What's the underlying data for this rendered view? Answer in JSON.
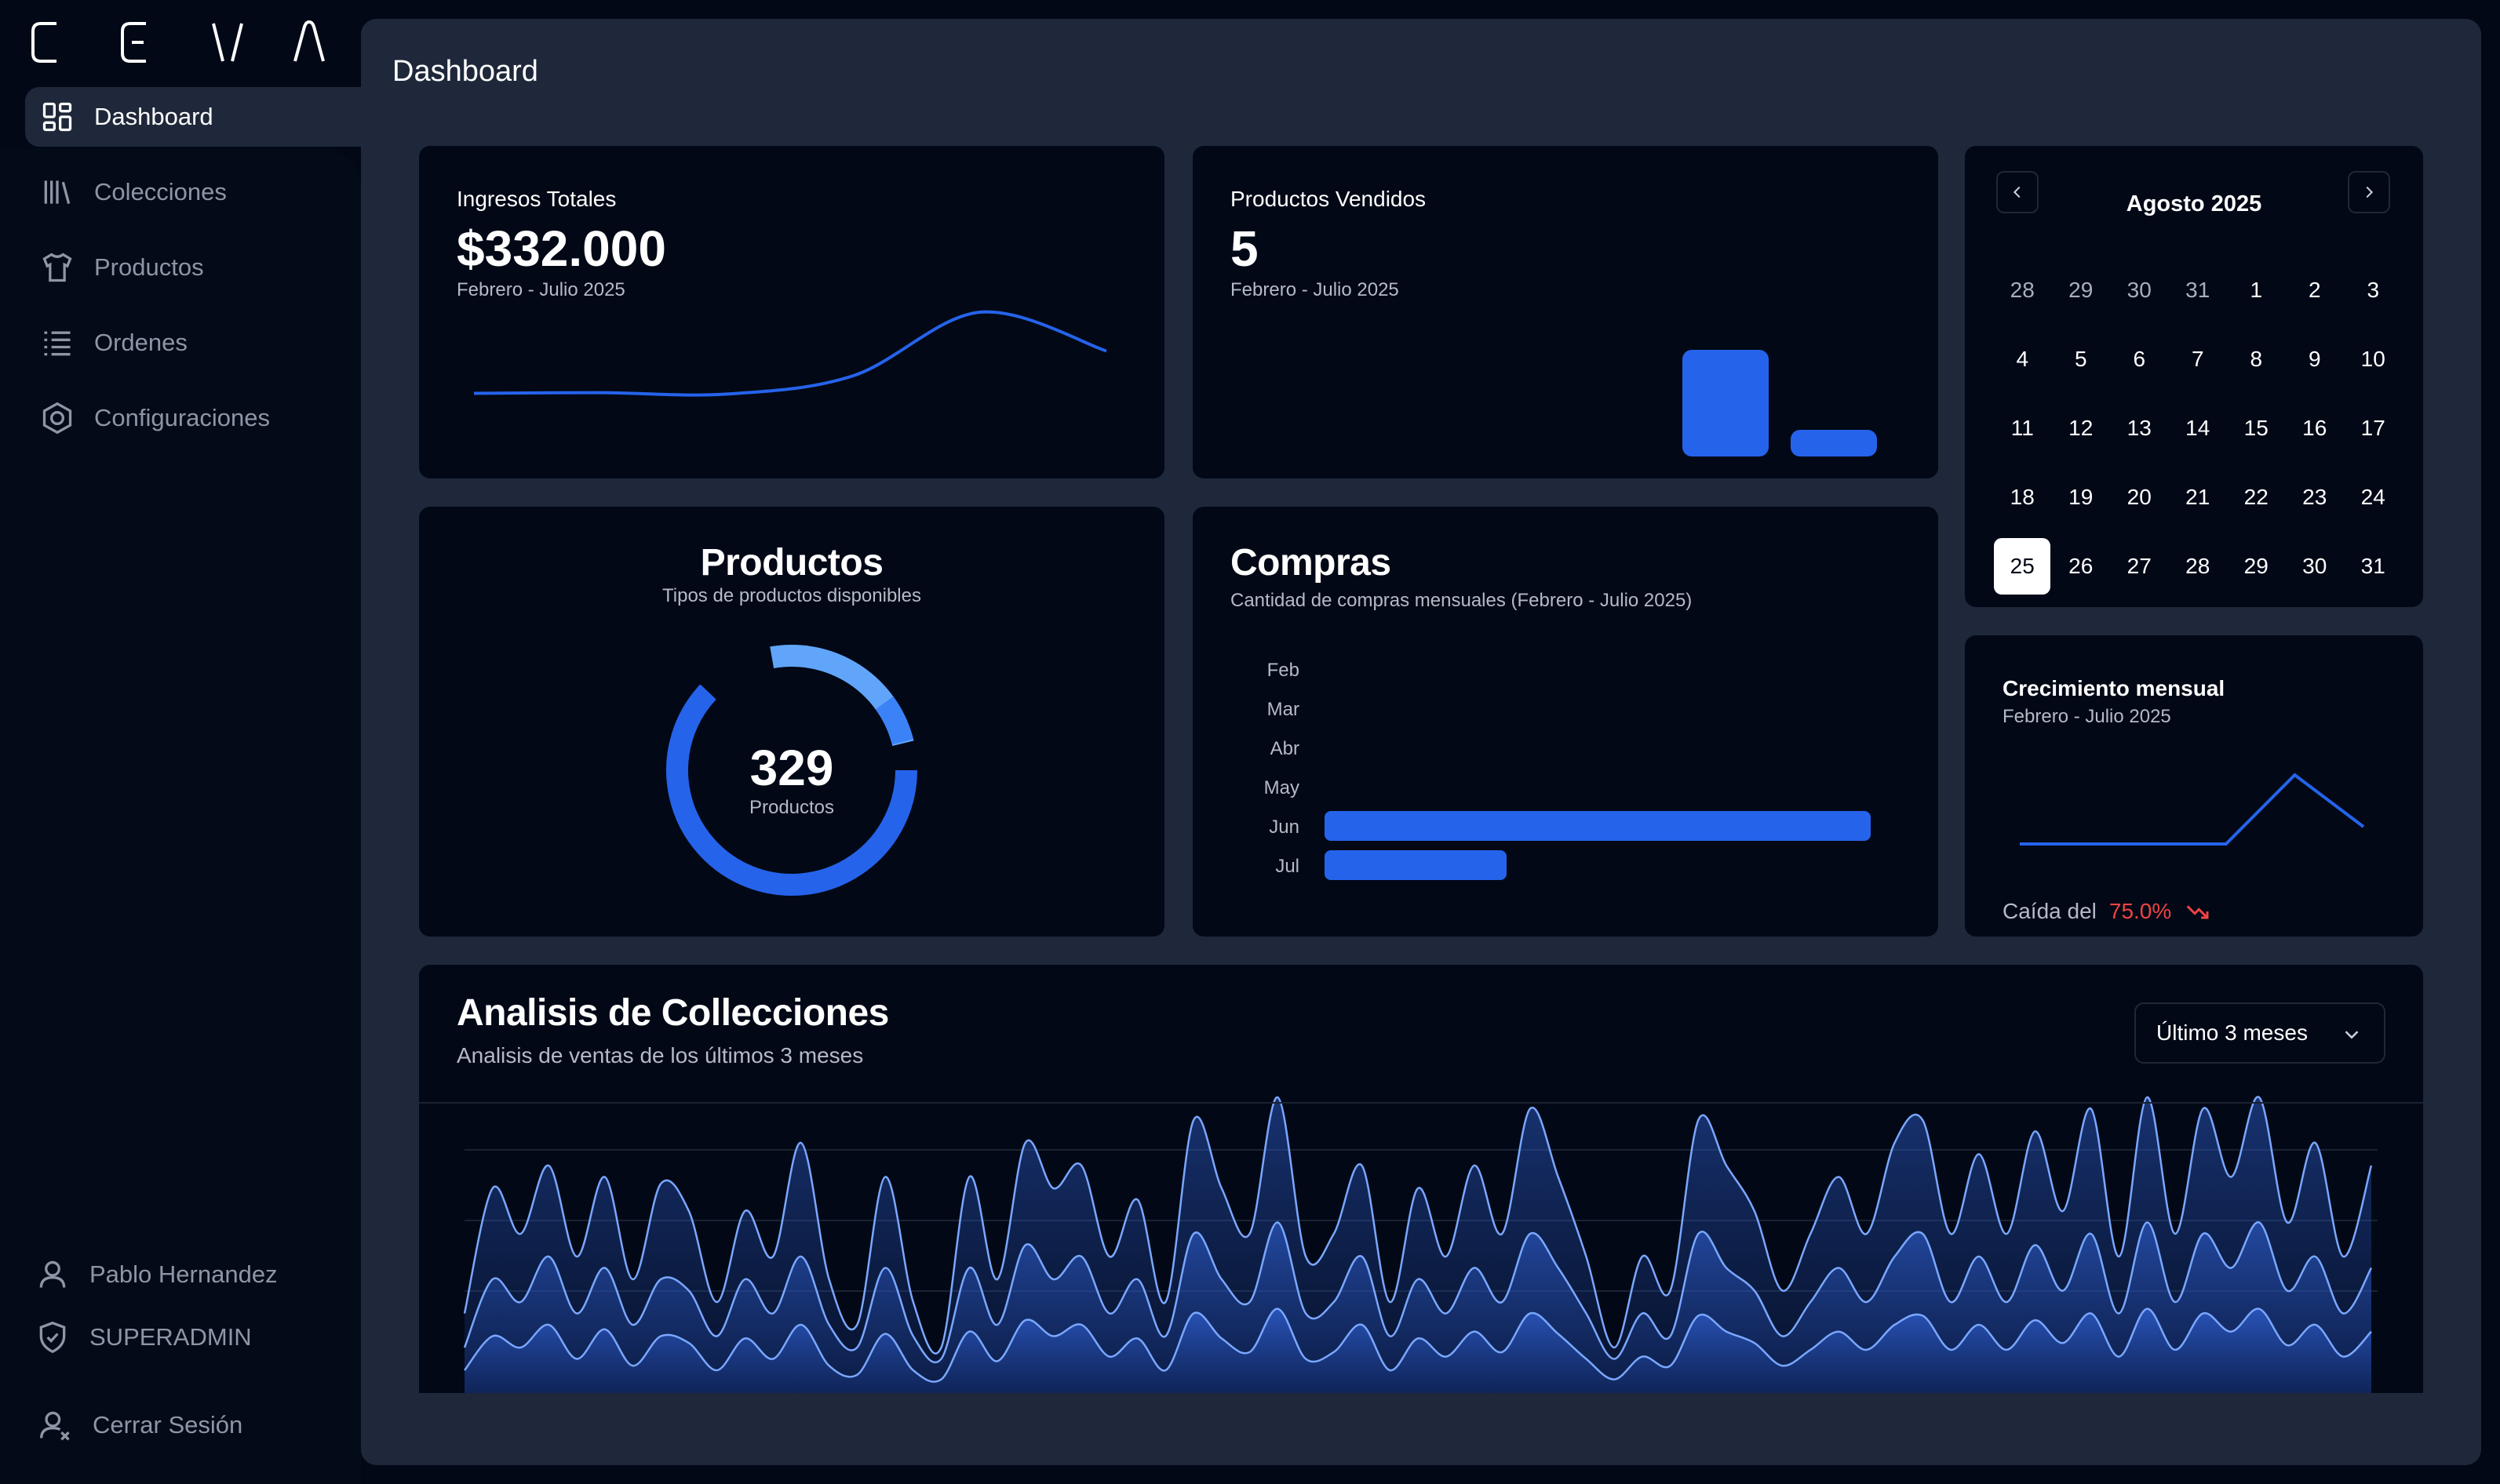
{
  "app": {
    "logo_text": "CEVA"
  },
  "sidebar": {
    "items": [
      {
        "label": "Dashboard",
        "icon": "dashboard-grid-icon",
        "active": true
      },
      {
        "label": "Colecciones",
        "icon": "library-icon",
        "active": false
      },
      {
        "label": "Productos",
        "icon": "shirt-icon",
        "active": false
      },
      {
        "label": "Ordenes",
        "icon": "list-icon",
        "active": false
      },
      {
        "label": "Configuraciones",
        "icon": "settings-hexagon-icon",
        "active": false
      }
    ],
    "user_name": "Pablo Hernandez",
    "user_role": "SUPERADMIN",
    "logout_label": "Cerrar Sesión"
  },
  "header": {
    "title": "Dashboard"
  },
  "revenue_card": {
    "label": "Ingresos Totales",
    "value": "$332.000",
    "period": "Febrero - Julio 2025"
  },
  "sold_card": {
    "label": "Productos Vendidos",
    "value": "5",
    "period": "Febrero - Julio 2025"
  },
  "products_card": {
    "title": "Productos",
    "subtitle": "Tipos de productos disponibles",
    "total": "329",
    "total_label": "Productos"
  },
  "purchases_card": {
    "title": "Compras",
    "subtitle": "Cantidad de compras mensuales (Febrero - Julio 2025)"
  },
  "calendar": {
    "title": "Agosto 2025",
    "weeks": [
      [
        {
          "d": "28",
          "muted": true
        },
        {
          "d": "29",
          "muted": true
        },
        {
          "d": "30",
          "muted": true
        },
        {
          "d": "31",
          "muted": true
        },
        {
          "d": "1"
        },
        {
          "d": "2"
        },
        {
          "d": "3"
        }
      ],
      [
        {
          "d": "4"
        },
        {
          "d": "5"
        },
        {
          "d": "6"
        },
        {
          "d": "7"
        },
        {
          "d": "8"
        },
        {
          "d": "9"
        },
        {
          "d": "10"
        }
      ],
      [
        {
          "d": "11"
        },
        {
          "d": "12"
        },
        {
          "d": "13"
        },
        {
          "d": "14"
        },
        {
          "d": "15"
        },
        {
          "d": "16"
        },
        {
          "d": "17"
        }
      ],
      [
        {
          "d": "18"
        },
        {
          "d": "19"
        },
        {
          "d": "20"
        },
        {
          "d": "21"
        },
        {
          "d": "22"
        },
        {
          "d": "23"
        },
        {
          "d": "24"
        }
      ],
      [
        {
          "d": "25",
          "selected": true
        },
        {
          "d": "26"
        },
        {
          "d": "27"
        },
        {
          "d": "28"
        },
        {
          "d": "29"
        },
        {
          "d": "30"
        },
        {
          "d": "31"
        }
      ]
    ]
  },
  "growth_card": {
    "title": "Crecimiento mensual",
    "period": "Febrero - Julio 2025",
    "drop_label": "Caída del",
    "drop_value": "75.0%"
  },
  "analysis": {
    "title": "Analisis de Collecciones",
    "subtitle": "Analisis de ventas de los últimos 3 meses",
    "range_selected": "Último 3 meses"
  },
  "colors": {
    "accent": "#2563eb",
    "accent_light": "#60a5fa",
    "negative": "#ef4444",
    "card_bg": "#020816",
    "panel_bg": "#1e283a"
  },
  "chart_data": [
    {
      "type": "bar",
      "name": "compras",
      "categories": [
        "Feb",
        "Mar",
        "Abr",
        "May",
        "Jun",
        "Jul"
      ],
      "values": [
        0,
        0,
        0,
        0,
        3,
        1
      ],
      "orientation": "horizontal",
      "color": "#2563eb"
    },
    {
      "type": "line",
      "name": "ingresos",
      "x": [
        "Feb",
        "Mar",
        "Abr",
        "May",
        "Jun",
        "Jul"
      ],
      "values": [
        10,
        12,
        8,
        60,
        240,
        130
      ],
      "color": "#2563eb"
    },
    {
      "type": "bar",
      "name": "productos-vendidos",
      "categories": [
        "Jun",
        "Jul"
      ],
      "values": [
        4,
        1
      ],
      "color": "#2563eb"
    },
    {
      "type": "pie",
      "name": "productos-tipos",
      "donut": true,
      "values": [
        62,
        24,
        6
      ],
      "colors": [
        "#2563eb",
        "#60a5fa",
        "#3b82f6"
      ]
    },
    {
      "type": "line",
      "name": "crecimiento",
      "x": [
        "Feb",
        "Mar",
        "Abr",
        "May",
        "Jun",
        "Jul"
      ],
      "values": [
        0,
        0,
        0,
        0,
        4,
        1
      ],
      "color": "#2563eb"
    },
    {
      "type": "area",
      "name": "analisis-colecciones",
      "series": [
        {
          "values": [
            0.35,
            0.9,
            0.7,
            1.0,
            0.6,
            0.95,
            0.5,
            0.92,
            0.8,
            0.4,
            0.8,
            0.6,
            1.1,
            0.5,
            0.3,
            0.95,
            0.4,
            0.2,
            0.95,
            0.5,
            1.1,
            0.9,
            1.0,
            0.6,
            0.85,
            0.4,
            1.2,
            0.9,
            0.7,
            1.3,
            0.6,
            0.7,
            1.0,
            0.4,
            0.9,
            0.6,
            1.0,
            0.7,
            1.25,
            0.95,
            0.6,
            0.2,
            0.6,
            0.45,
            1.2,
            1.0,
            0.8,
            0.45,
            0.7,
            0.95,
            0.7,
            1.1,
            1.2,
            0.7,
            1.05,
            0.7,
            1.15,
            0.8,
            1.25,
            0.6,
            1.3,
            0.7,
            1.25,
            0.95,
            1.3,
            0.75,
            1.1,
            0.6,
            1.0
          ]
        },
        {
          "values": [
            0.2,
            0.5,
            0.4,
            0.6,
            0.35,
            0.55,
            0.3,
            0.5,
            0.45,
            0.25,
            0.5,
            0.35,
            0.6,
            0.3,
            0.2,
            0.55,
            0.25,
            0.15,
            0.55,
            0.3,
            0.65,
            0.5,
            0.6,
            0.35,
            0.5,
            0.25,
            0.7,
            0.5,
            0.4,
            0.75,
            0.35,
            0.4,
            0.6,
            0.25,
            0.5,
            0.35,
            0.55,
            0.4,
            0.7,
            0.55,
            0.35,
            0.15,
            0.35,
            0.25,
            0.7,
            0.55,
            0.45,
            0.25,
            0.4,
            0.55,
            0.4,
            0.6,
            0.7,
            0.4,
            0.6,
            0.4,
            0.65,
            0.45,
            0.7,
            0.35,
            0.75,
            0.4,
            0.7,
            0.55,
            0.75,
            0.45,
            0.6,
            0.35,
            0.55
          ]
        },
        {
          "values": [
            0.1,
            0.25,
            0.2,
            0.3,
            0.15,
            0.28,
            0.12,
            0.25,
            0.22,
            0.1,
            0.24,
            0.15,
            0.3,
            0.12,
            0.08,
            0.26,
            0.1,
            0.06,
            0.27,
            0.14,
            0.32,
            0.25,
            0.3,
            0.16,
            0.24,
            0.1,
            0.35,
            0.24,
            0.18,
            0.37,
            0.15,
            0.18,
            0.3,
            0.1,
            0.24,
            0.16,
            0.27,
            0.18,
            0.35,
            0.26,
            0.15,
            0.06,
            0.16,
            0.12,
            0.34,
            0.27,
            0.22,
            0.12,
            0.19,
            0.27,
            0.19,
            0.3,
            0.34,
            0.19,
            0.3,
            0.19,
            0.32,
            0.22,
            0.35,
            0.16,
            0.37,
            0.19,
            0.35,
            0.27,
            0.37,
            0.21,
            0.3,
            0.16,
            0.27
          ]
        }
      ]
    }
  ]
}
